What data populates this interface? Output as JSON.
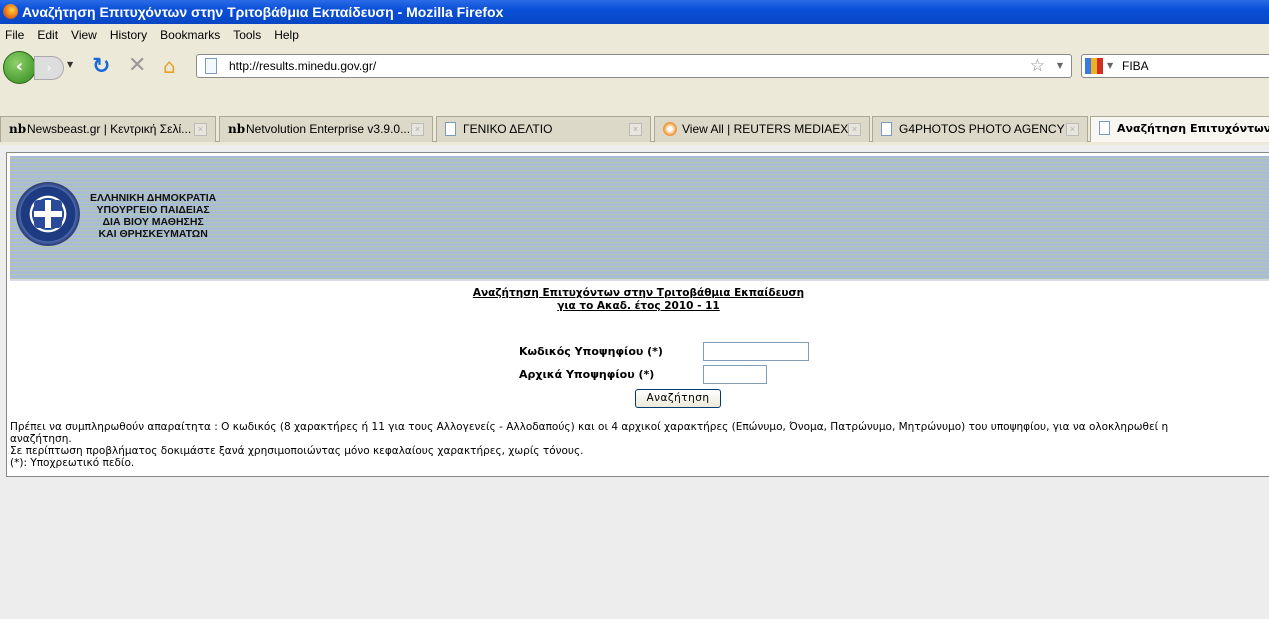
{
  "window": {
    "title": "Αναζήτηση Επιτυχόντων στην Τριτοβάθμια Εκπαίδευση - Mozilla Firefox"
  },
  "menu": [
    "File",
    "Edit",
    "View",
    "History",
    "Bookmarks",
    "Tools",
    "Help"
  ],
  "navigation": {
    "url": "http://results.minedu.gov.gr/",
    "search_value": "FIBA"
  },
  "tabs": [
    {
      "label": "Newsbeast.gr | Κεντρική Σελί...",
      "icon": "nb-icon"
    },
    {
      "label": "Netvolution Enterprise v3.9.0...",
      "icon": "nb-icon"
    },
    {
      "label": "ΓΕΝΙΚΟ ΔΕΛΤΙΟ",
      "icon": "page-icon"
    },
    {
      "label": "View All | REUTERS MEDIAEX...",
      "icon": "reuters-icon"
    },
    {
      "label": "G4PHOTOS PHOTO AGENCY",
      "icon": "page-icon"
    },
    {
      "label": "Αναζήτηση Επιτυχόντων...",
      "icon": "page-icon",
      "active": true
    }
  ],
  "banner": {
    "lines": [
      "ΕΛΛΗΝΙΚΗ ΔΗΜΟΚΡΑΤΙΑ",
      "ΥΠΟΥΡΓΕΙΟ ΠΑΙΔΕΙΑΣ",
      "ΔΙΑ ΒΙΟΥ ΜΑΘΗΣΗΣ",
      "ΚΑΙ ΘΡΗΣΚΕΥΜΑΤΩΝ"
    ]
  },
  "form": {
    "heading1": "Αναζήτηση Επιτυχόντων στην Τριτοβάθμια Εκπαίδευση",
    "heading2": "για το Ακαδ. έτος 2010 - 11",
    "code_label": "Κωδικός Υποψηφίου (*)",
    "code_value": "",
    "initials_label": "Αρχικά Υποψηφίου (*)",
    "initials_value": "",
    "submit_label": "Αναζήτηση"
  },
  "notes": [
    "Πρέπει να συμπληρωθούν απαραίτητα : Ο κωδικός (8 χαρακτήρες ή 11 για τους Αλλογενείς - Αλλοδαπούς) και οι 4 αρχικοί χαρακτήρες (Επώνυμο, Όνομα, Πατρώνυμο, Μητρώνυμο) του υποψηφίου, για να ολοκληρωθεί η",
    "αναζήτηση.",
    "Σε περίπτωση προβλήματος δοκιμάστε ξανά χρησιμοποιώντας μόνο κεφαλαίους χαρακτήρες, χωρίς τόνους.",
    "(*): Υποχρεωτικό πεδίο."
  ]
}
